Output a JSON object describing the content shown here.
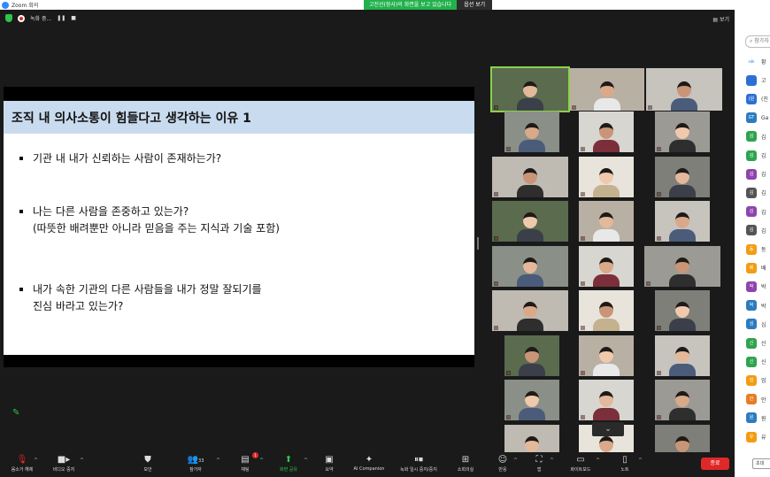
{
  "window": {
    "title": "Zoom 회의"
  },
  "share_banner": {
    "message": "고진선(장사)의 화면을 보고 있습니다",
    "view_options": "옵션 보기"
  },
  "meeting_top": {
    "recording_label": "녹화 중...",
    "view_label": "보기"
  },
  "slide": {
    "title": "조직 내 의사소통이 힘들다고 생각하는 이유 1",
    "bullets": [
      {
        "line1": "기관 내 내가 신뢰하는 사람이 존재하는가?",
        "line2": ""
      },
      {
        "line1": "나는 다른 사람을 존중하고 있는가?",
        "line2": "(따뜻한 배려뿐만 아니라 믿음을 주는 지식과 기술 포함)"
      },
      {
        "line1": "내가 속한 기관의 다른 사람들을 내가 정말 잘되기를",
        "line2": "진심 바라고 있는가?"
      }
    ]
  },
  "toolbar": {
    "mute": "음소거 해제",
    "video": "비디오 중지",
    "security": "보안",
    "participants": "참가자",
    "participants_count": "33",
    "chat": "채팅",
    "chat_badge": "1",
    "share": "화면 공유",
    "summary": "요약",
    "ai_companion": "AI Companion",
    "pause_recording": "녹화 일시 중지/중지",
    "apps": "소회의실",
    "reactions": "반응",
    "apps2": "앱",
    "whiteboard": "화이트보드",
    "notes": "노트",
    "end": "종료"
  },
  "participants_panel": {
    "search_placeholder": "참가자",
    "items": [
      {
        "initial": "sdk",
        "name": "황",
        "color": "#ffffff"
      },
      {
        "initial": "",
        "name": "고",
        "color": "#2d6fd6"
      },
      {
        "initial": "(원",
        "name": "(진",
        "color": "#2d6fd6"
      },
      {
        "initial": "GT",
        "name": "Ga",
        "color": "#2b7bbf"
      },
      {
        "initial": "김",
        "name": "김",
        "color": "#2ea44f"
      },
      {
        "initial": "김",
        "name": "김",
        "color": "#2ea44f"
      },
      {
        "initial": "김",
        "name": "김",
        "color": "#8e44ad"
      },
      {
        "initial": "김",
        "name": "김",
        "color": "#555555"
      },
      {
        "initial": "김",
        "name": "김",
        "color": "#8e44ad"
      },
      {
        "initial": "김",
        "name": "김",
        "color": "#555555"
      },
      {
        "initial": "동",
        "name": "동",
        "color": "#f39c12"
      },
      {
        "initial": "배",
        "name": "배",
        "color": "#f39c12"
      },
      {
        "initial": "박",
        "name": "박",
        "color": "#8e44ad"
      },
      {
        "initial": "박",
        "name": "박",
        "color": "#2b7bbf"
      },
      {
        "initial": "심",
        "name": "심",
        "color": "#2b7bbf"
      },
      {
        "initial": "신",
        "name": "신",
        "color": "#2ea44f"
      },
      {
        "initial": "신",
        "name": "신",
        "color": "#2ea44f"
      },
      {
        "initial": "엄",
        "name": "엄",
        "color": "#f39c12"
      },
      {
        "initial": "안",
        "name": "안",
        "color": "#e67e22"
      },
      {
        "initial": "원",
        "name": "원",
        "color": "#2b7bbf"
      },
      {
        "initial": "유",
        "name": "유",
        "color": "#f39c12"
      }
    ],
    "invite": "초대"
  }
}
